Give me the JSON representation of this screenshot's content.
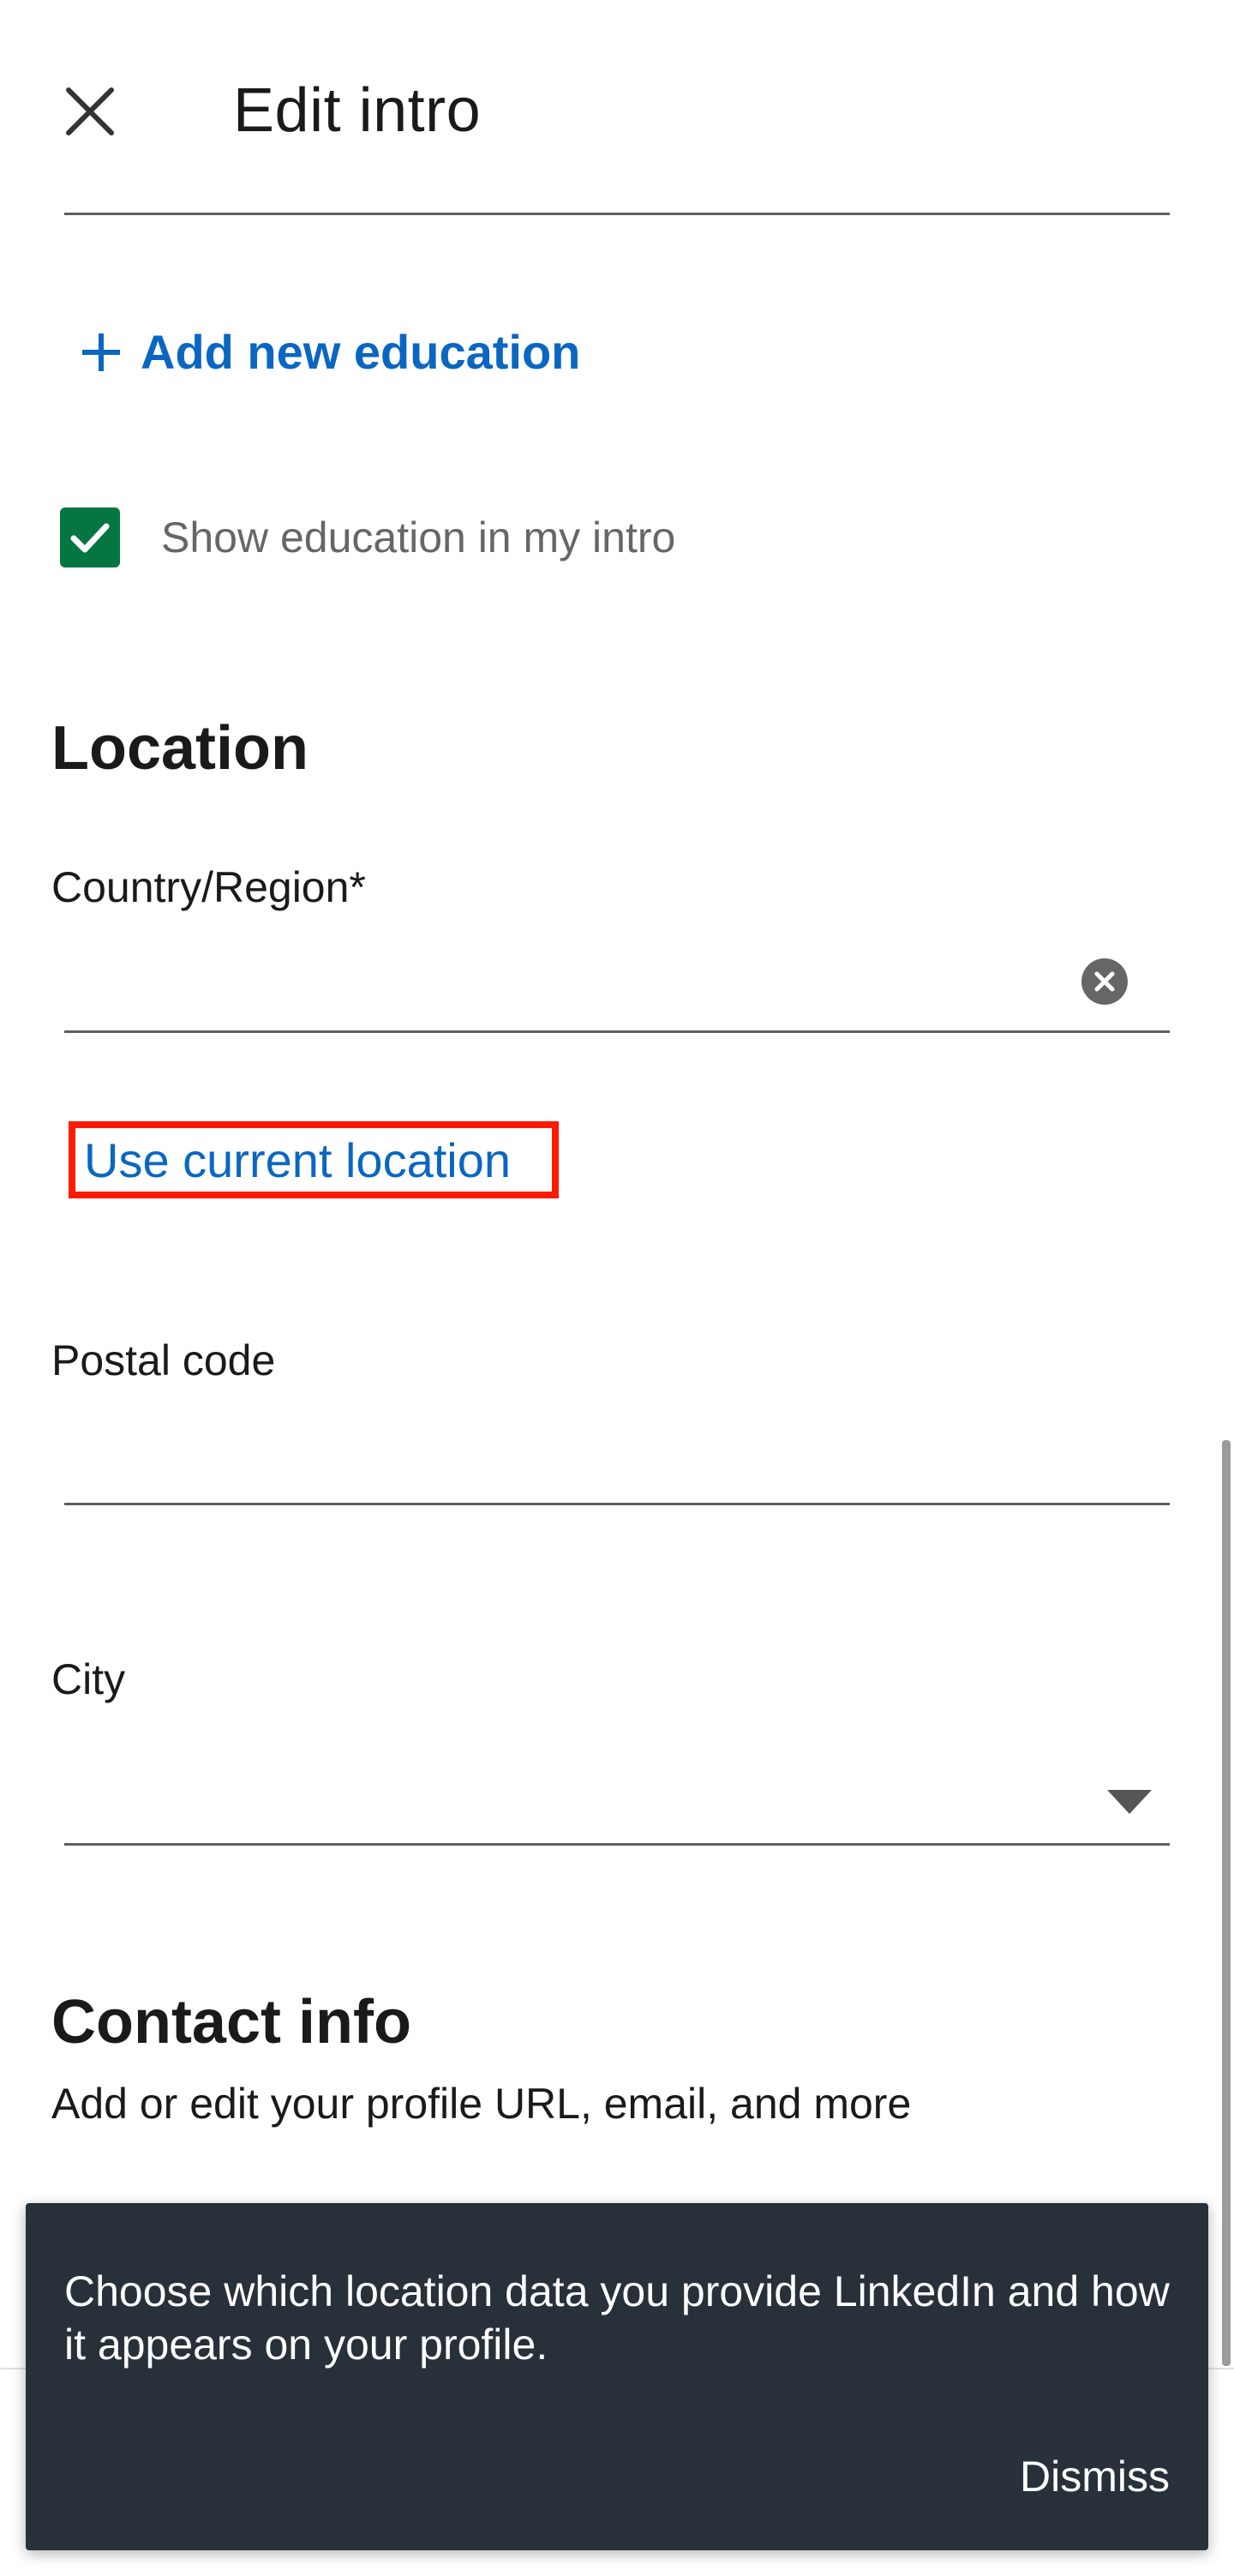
{
  "header": {
    "title": "Edit intro",
    "close_icon": "close-icon"
  },
  "education": {
    "add_label": "Add new education",
    "add_icon": "plus-icon",
    "show_in_intro_label": "Show education in my intro",
    "show_in_intro_checked": true
  },
  "location": {
    "title": "Location",
    "country_label": "Country/Region*",
    "country_value": "",
    "use_current_location": "Use current location",
    "postal_label": "Postal code",
    "postal_value": "",
    "city_label": "City",
    "city_value": ""
  },
  "contact": {
    "title": "Contact info",
    "subtitle": "Add or edit your profile URL, email, and more"
  },
  "toast": {
    "message": "Choose which location data you provide LinkedIn and how it appears on your profile.",
    "dismiss_label": "Dismiss"
  },
  "colors": {
    "link": "#0a66c2",
    "checkbox": "#057642",
    "highlight": "#ff1a00",
    "toast_bg": "#283039"
  }
}
